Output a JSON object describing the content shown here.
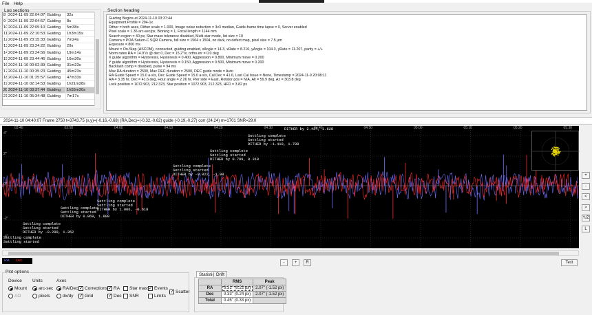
{
  "menu": [
    "File",
    "Help"
  ],
  "log_sections": {
    "label": "Log sections",
    "rows": [
      {
        "n": "8",
        "date": "2024-11-09 22:04:07",
        "type": "Guiding",
        "dur": "32s"
      },
      {
        "n": "9",
        "date": "2024-11-09 22:04:57",
        "type": "Guiding",
        "dur": "8s"
      },
      {
        "n": "10",
        "date": "2024-11-09 22:05:10",
        "type": "Guiding",
        "dur": "5m38s"
      },
      {
        "n": "11",
        "date": "2024-11-09 22:10:53",
        "type": "Guiding",
        "dur": "1h3m15s"
      },
      {
        "n": "12",
        "date": "2024-11-09 23:15:33",
        "type": "Guiding",
        "dur": "7m24s"
      },
      {
        "n": "13",
        "date": "2024-11-09 23:24:22",
        "type": "Guiding",
        "dur": "29s"
      },
      {
        "n": "14",
        "date": "2024-11-09 23:24:56",
        "type": "Guiding",
        "dur": "19m14s"
      },
      {
        "n": "15",
        "date": "2024-11-09 23:44:46",
        "type": "Guiding",
        "dur": "16m30s"
      },
      {
        "n": "16",
        "date": "2024-11-10 00:02:39",
        "type": "Guiding",
        "dur": "31m23s"
      },
      {
        "n": "17",
        "date": "2024-11-10 00:35:23",
        "type": "Guiding",
        "dur": "45m23s"
      },
      {
        "n": "18",
        "date": "2024-11-10 01:25:57",
        "type": "Guiding",
        "dur": "47m33s"
      },
      {
        "n": "19",
        "date": "2024-11-10 02:14:53",
        "type": "Guiding",
        "dur": "1h21m28s"
      },
      {
        "n": "20",
        "date": "2024-11-10 03:37:44",
        "type": "Guiding",
        "dur": "1h55m30s",
        "selected": true
      },
      {
        "n": "21",
        "date": "2024-11-10 05:34:48",
        "type": "Guiding",
        "dur": "7m17s"
      }
    ]
  },
  "section_heading": {
    "label": "Section heading",
    "lines": [
      "Guiding Begins at 2024-11-10 03:37:44",
      "Equipment Profile = 294-1x",
      "Dither = both axes, Dither scale = 1.000, Image noise reduction = 3x3 median, Guide-frame time lapse = 0, Server enabled",
      "Pixel scale = 1.36 arc-sec/px, Binning = 1, Focal length = 1144 mm",
      "Search region = 40 px, Star mass tolerance disabled, Multi-star mode, list size = 10",
      "Camera = POA Saturn-C SQR Camera, full size = 1504 x 1504, no dark, no defect map, pixel size = 7.5 µm",
      "Exposure = 800 ms",
      "Mount = On-Step (ASCOM), connected, guiding enabled, xAngle = 14.3, xRate = 8.216, yAngle = 104.3, yRate = 11.207, parity = +/+",
      "Norm rates RA = 14.9\"/s @ dec 0, Dec = 15.2\"/s; ortho.err = 0.0 deg",
      "X guide algorithm = Hysteresis, Hysteresis = 0.400, Aggression = 0.800, Minimum move = 0.200",
      "Y guide algorithm = Hysteresis, Hysteresis = 0.150, Aggression = 0.500, Minimum move = 0.200",
      "Backlash comp = disabled, pulse = 94 ms",
      "Max RA duration = 2500, Max DEC duration = 2500, DEC guide mode = Auto",
      "RA Guide Speed = 15.0 a-s/s, Dec Guide Speed = 15.0 a-s/s, Cal Dec = 41.6, Last Cal Issue = None, Timestamp = 2024-11-9 20:08:11",
      "RA = 3.35 hr, Dec = 41.6 deg, Hour angle = 2.26 hr, Pier side = East, Rotator pos = N/A, Alt = 59.9 deg, Az = 303.8 deg",
      "Lock position = 1072.903, 212.323, Star position = 1072.903, 212.323, HFD = 3.82 px"
    ]
  },
  "info_bar": "2024-11-10 04:40:07 Frame 2750 t=3743.75 (x,y)=(-0.16,-0.68) (RA,Dec)=(-0.32,-0.62) guide (-0.19,-0.27) corr (24,24) m=1701 SNR=29.0",
  "graph": {
    "time_ticks": [
      "03:40",
      "03:50",
      "04:00",
      "04:10",
      "04:20",
      "04:30",
      "04:40",
      "04:50",
      "05:00",
      "05:10",
      "05:20",
      "05:30"
    ],
    "y_labels": [
      "4\"",
      "2\"",
      "0\"",
      "-2\"",
      "-4\""
    ],
    "annotations": [
      {
        "lines": [
          "DITHER by 2.434, 1.628"
        ]
      },
      {
        "lines": [
          "Settling complete",
          "Settling started",
          "DITHER by -1.410, 1.788"
        ]
      },
      {
        "lines": [
          "Settling complete",
          "Settling started",
          "DITHER by 0.799, 0.318"
        ]
      },
      {
        "lines": [
          "Settling complete",
          "Settling started",
          "DITHER by -0.022, -1.98"
        ]
      },
      {
        "lines": [
          "Settling complete",
          "Settling started",
          "DITHER by 1.006, -0.618"
        ]
      },
      {
        "lines": [
          "Settling complete",
          "Settling started",
          "DITHER by 0.069, 1.880"
        ]
      },
      {
        "lines": [
          "Settling complete",
          "Settling started",
          "DITHER by -0.299, 1.352"
        ]
      },
      {
        "lines": [
          "Settling complete",
          "Settling started"
        ]
      }
    ]
  },
  "side_buttons": [
    "+",
    "-",
    "<",
    ">",
    "Y/Z",
    "L"
  ],
  "zoom_buttons": [
    "-",
    "+",
    "R"
  ],
  "text_button": "Text",
  "legend": {
    "ra": "RA",
    "dec": "Dec"
  },
  "plot_options": {
    "label": "Plot options",
    "device": {
      "label": "Device",
      "options": [
        "Mount",
        "AO"
      ]
    },
    "units": {
      "label": "Units",
      "options": [
        "arc-sec",
        "pixels"
      ]
    },
    "axes": {
      "label": "Axes",
      "options": [
        "RA/Dec",
        "dx/dy"
      ]
    },
    "checks": {
      "corrections": "Corrections",
      "grid": "Grid",
      "ra": "RA",
      "dec": "Dec",
      "star_mass": "Star mass",
      "snr": "SNR",
      "events": "Events",
      "limits": "Limits",
      "scatter": "Scatter"
    }
  },
  "stats": {
    "tabs": [
      "Statistics",
      "Drift"
    ],
    "headers": [
      "",
      "RMS",
      "Peak"
    ],
    "rows": [
      {
        "name": "RA",
        "rms": "0.31\" (0.22 px)",
        "peak": "2.07\" (-1.52 px)"
      },
      {
        "name": "Dec",
        "rms": "0.33\" (0.24 px)",
        "peak": "2.07\" (-1.52 px)"
      },
      {
        "name": "Total",
        "rms": "0.45\" (0.33 px)",
        "peak": ""
      }
    ]
  },
  "colors": {
    "ra": "#6f6fff",
    "dec": "#ff2a2a",
    "graph_bg": "#000000"
  }
}
